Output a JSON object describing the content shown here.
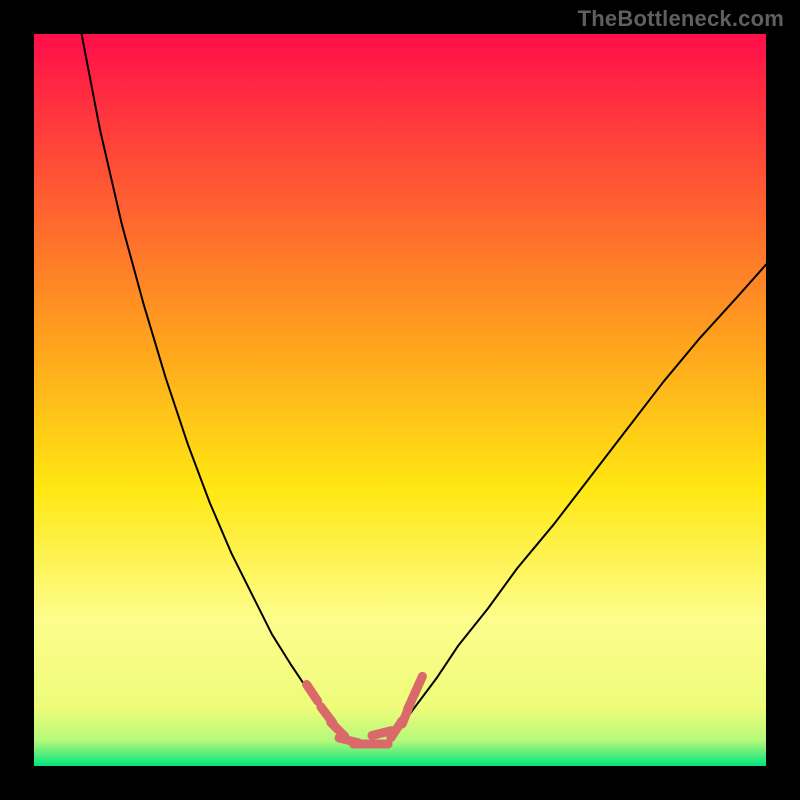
{
  "watermark": "TheBottleneck.com",
  "chart_data": {
    "type": "line",
    "title": "",
    "xlabel": "",
    "ylabel": "",
    "xlim": [
      0,
      100
    ],
    "ylim": [
      0,
      100
    ],
    "grid": false,
    "legend": false,
    "gradient_stops": [
      {
        "offset": 0,
        "color": "#ff0e4a"
      },
      {
        "offset": 0.4,
        "color": "#ff9b1f"
      },
      {
        "offset": 0.62,
        "color": "#ffe712"
      },
      {
        "offset": 0.8,
        "color": "#fdfd8c"
      },
      {
        "offset": 0.92,
        "color": "#eefc7a"
      },
      {
        "offset": 0.965,
        "color": "#b6f97a"
      },
      {
        "offset": 1.0,
        "color": "#00e57d"
      }
    ],
    "series": [
      {
        "name": "left-curve",
        "color": "#000000",
        "width": 2.0,
        "x": [
          6.5,
          9.0,
          12.0,
          15.0,
          18.0,
          21.0,
          24.0,
          27.0,
          30.0,
          32.5,
          35.0,
          37.0,
          39.0,
          42.0
        ],
        "y": [
          100.0,
          87.0,
          74.0,
          63.0,
          53.0,
          44.0,
          36.0,
          29.0,
          23.0,
          18.0,
          14.0,
          11.0,
          8.5,
          4.5
        ]
      },
      {
        "name": "right-curve",
        "color": "#000000",
        "width": 2.0,
        "x": [
          49.5,
          52.0,
          55.0,
          58.0,
          62.0,
          66.0,
          71.0,
          76.0,
          81.0,
          86.0,
          91.0,
          96.0,
          100.0
        ],
        "y": [
          4.5,
          8.0,
          12.0,
          16.5,
          21.5,
          27.0,
          33.0,
          39.5,
          46.0,
          52.5,
          58.5,
          64.0,
          68.5
        ]
      },
      {
        "name": "trough-left-marks",
        "color": "#da6a6a",
        "width": 9.0,
        "x": [
          38.0,
          40.0,
          41.5,
          43.0,
          45.0,
          47.0
        ],
        "y": [
          10.0,
          7.0,
          5.0,
          3.5,
          3.0,
          3.0
        ]
      },
      {
        "name": "trough-right-marks",
        "color": "#da6a6a",
        "width": 9.0,
        "x": [
          47.5,
          49.5,
          50.8,
          51.6,
          52.5
        ],
        "y": [
          4.5,
          5.0,
          7.0,
          9.0,
          11.0
        ]
      }
    ],
    "annotations": []
  }
}
